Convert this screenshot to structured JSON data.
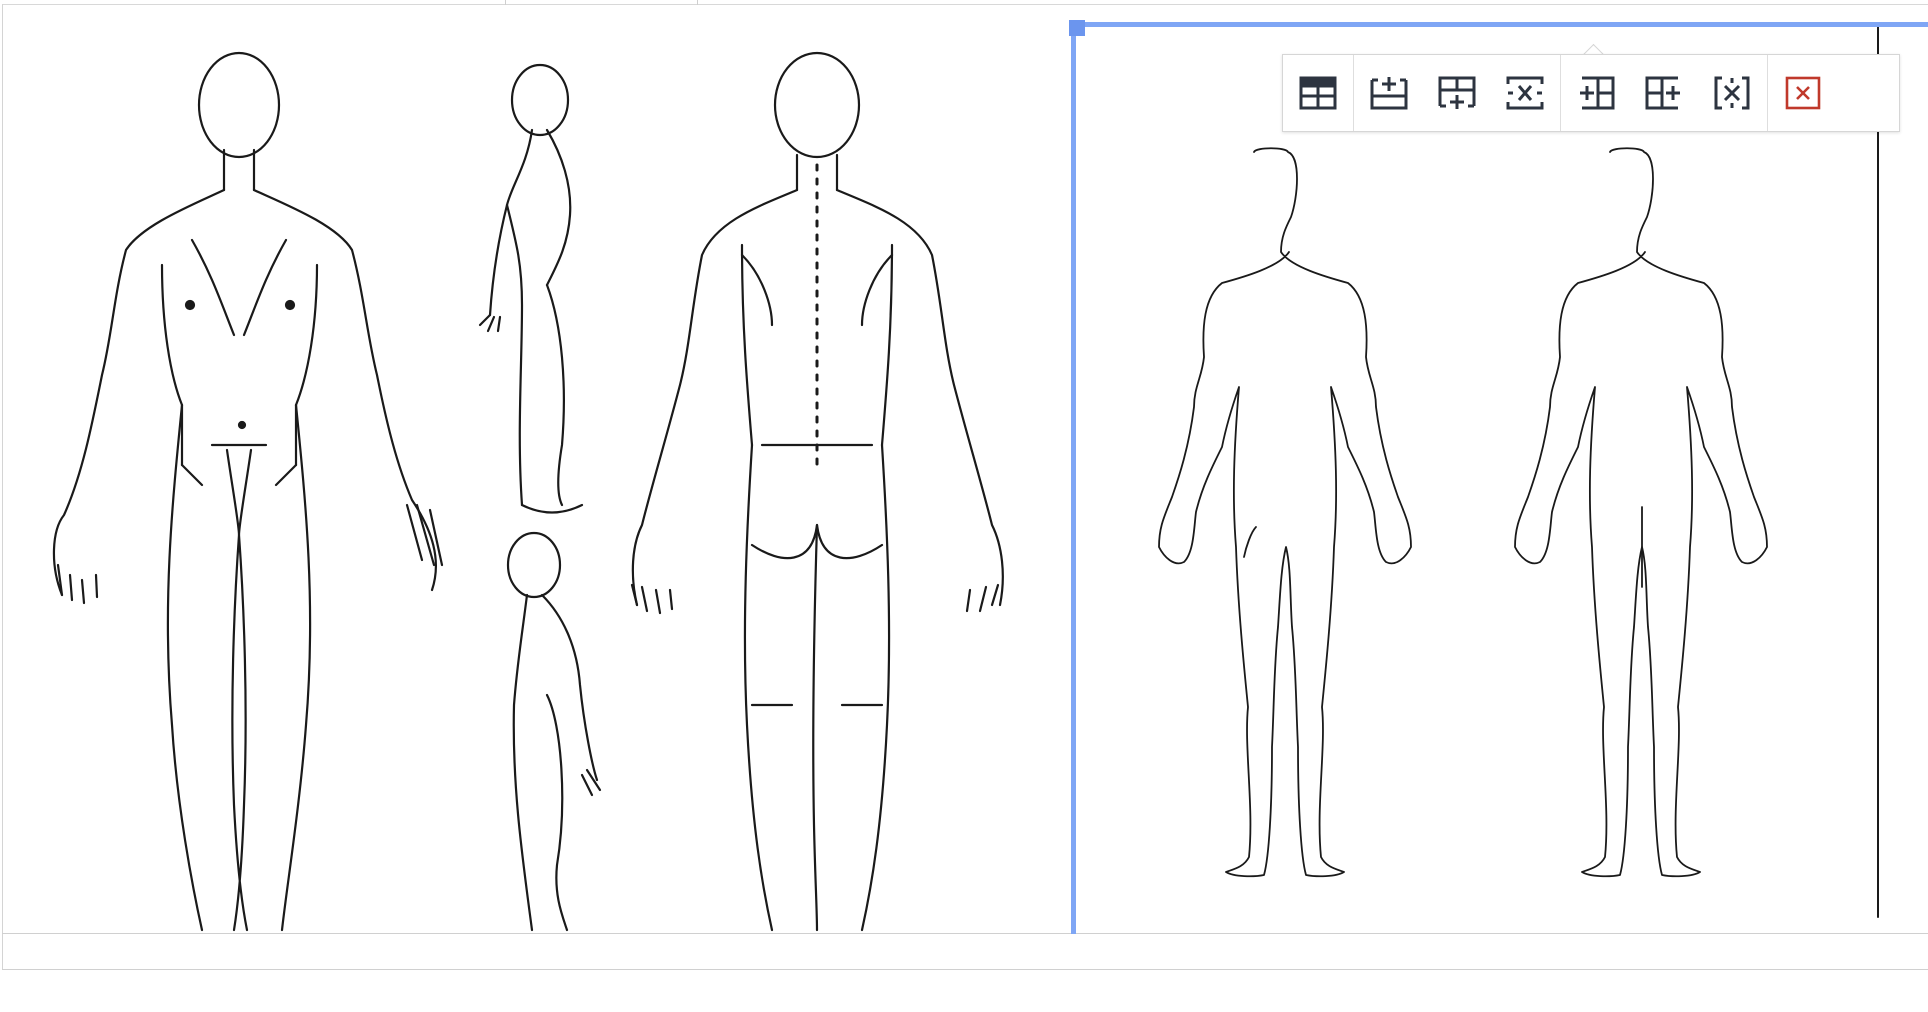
{
  "app": {
    "view": "table-cell-editor"
  },
  "table": {
    "rows": 2,
    "columns": 2,
    "cells": [
      {
        "row": 0,
        "col": 0,
        "content": "body-diagram-image",
        "selected": false
      },
      {
        "row": 0,
        "col": 1,
        "content": "body-outline-image",
        "selected": true
      },
      {
        "row": 1,
        "col": 0,
        "content": "",
        "selected": false
      },
      {
        "row": 1,
        "col": 1,
        "content": "",
        "selected": false
      }
    ]
  },
  "toolbar": {
    "groups": [
      {
        "name": "table",
        "buttons": [
          {
            "icon": "table-properties-icon",
            "color": "#2d3440"
          }
        ]
      },
      {
        "name": "rows",
        "buttons": [
          {
            "icon": "insert-row-above-icon",
            "color": "#2d3440"
          },
          {
            "icon": "insert-row-below-icon",
            "color": "#2d3440"
          },
          {
            "icon": "delete-row-icon",
            "color": "#2d3440"
          }
        ]
      },
      {
        "name": "columns",
        "buttons": [
          {
            "icon": "insert-column-left-icon",
            "color": "#2d3440"
          },
          {
            "icon": "insert-column-right-icon",
            "color": "#2d3440"
          },
          {
            "icon": "delete-column-icon",
            "color": "#2d3440"
          }
        ]
      },
      {
        "name": "delete",
        "buttons": [
          {
            "icon": "delete-table-icon",
            "color": "#c0392b"
          }
        ]
      }
    ]
  },
  "colors": {
    "selection": "#7fa6f5",
    "grid": "#cfcfcf",
    "icon": "#2d3440",
    "danger": "#c0392b"
  }
}
